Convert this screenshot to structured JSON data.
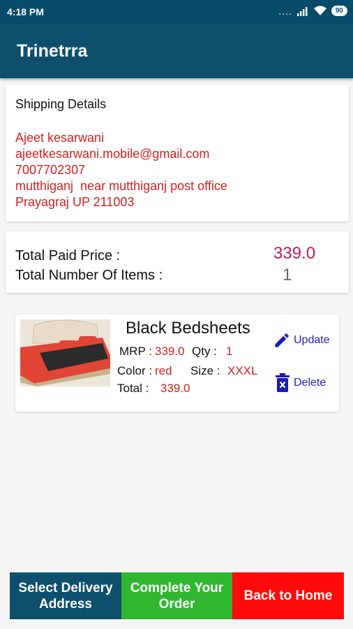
{
  "status_bar": {
    "time": "4:18 PM",
    "signal_dots": "....",
    "battery": "90"
  },
  "app_bar": {
    "title": "Trinetrra"
  },
  "shipping": {
    "heading": "Shipping Details",
    "name": "Ajeet kesarwani",
    "email": "ajeetkesarwani.mobile@gmail.com",
    "phone": "7007702307",
    "address_line": "mutthiganj  near mutthiganj post office",
    "city_line": "Prayagraj UP 211003"
  },
  "totals": {
    "price_label": "Total Paid Price :",
    "price_value": "339.0",
    "items_label": "Total Number Of Items :",
    "items_value": "1"
  },
  "cart_item": {
    "name": "Black Bedsheets",
    "mrp_label": "MRP :",
    "mrp_value": "339.0",
    "qty_label": "Qty :",
    "qty_value": "1",
    "color_label": "Color :",
    "color_value": "red",
    "size_label": "Size :",
    "size_value": "XXXL",
    "total_label": "Total :",
    "total_value": "339.0",
    "update_label": "Update",
    "delete_label": "Delete"
  },
  "bottom_buttons": {
    "select_address": "Select Delivery\nAddress",
    "complete_order": "Complete Your\nOrder",
    "back_home": "Back to Home"
  },
  "colors": {
    "primary": "#0e4f6e",
    "accent_red": "#d32020",
    "price_pink": "#c2185b",
    "link_blue": "#2020c0",
    "green": "#2fb82f",
    "red_button": "#ff0a0a"
  }
}
